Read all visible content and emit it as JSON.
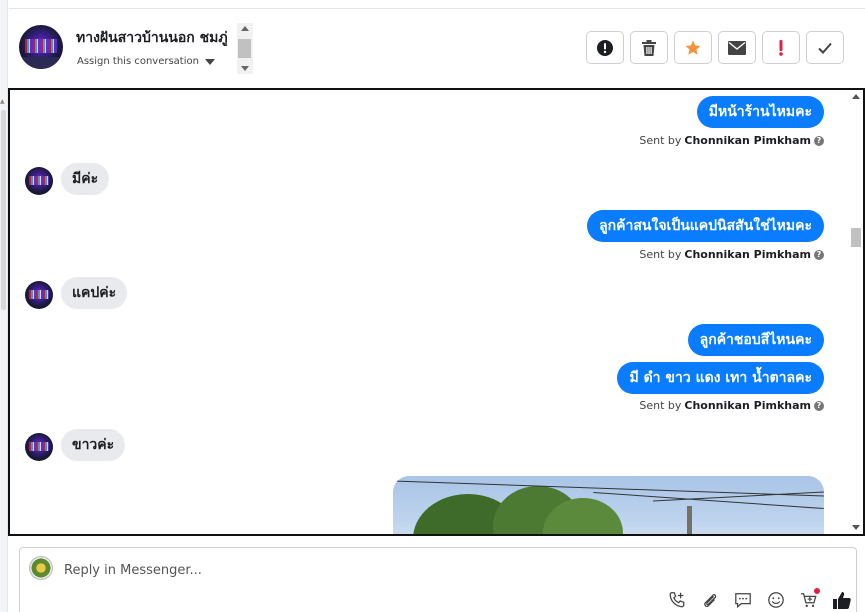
{
  "header": {
    "contact_name": "ทางฝันสาวบ้านนอก ชมภู่",
    "assign_label": "Assign this conversation"
  },
  "actions": [
    {
      "icon": "alert-circle-icon",
      "label": "Mark as spam"
    },
    {
      "icon": "trash-icon",
      "label": "Delete"
    },
    {
      "icon": "star-icon",
      "label": "Star"
    },
    {
      "icon": "envelope-icon",
      "label": "Mark as unread"
    },
    {
      "icon": "exclamation-icon",
      "label": "Important"
    },
    {
      "icon": "checkmark-icon",
      "label": "Done"
    }
  ],
  "messages": {
    "m1": "มีหน้าร้านไหมคะ",
    "m2": "มีค่ะ",
    "m3": "ลูกค้าสนใจเป็นแคปนิสสันใช่ไหมคะ",
    "m4": "แคปค่ะ",
    "m5": "ลูกค้าชอบสีไหนคะ",
    "m6": "มี ดำ ขาว แดง เทา น้ำตาลคะ",
    "m7": "ขาวค่ะ"
  },
  "sent_by": {
    "prefix": "Sent by",
    "agent": "Chonnikan Pimkham"
  },
  "composer": {
    "placeholder": "Reply in Messenger..."
  },
  "colors": {
    "outgoing_bubble": "#0a7cff",
    "incoming_bubble": "#e9eaed",
    "star": "#f7923b",
    "exclamation": "#e41e3f"
  }
}
